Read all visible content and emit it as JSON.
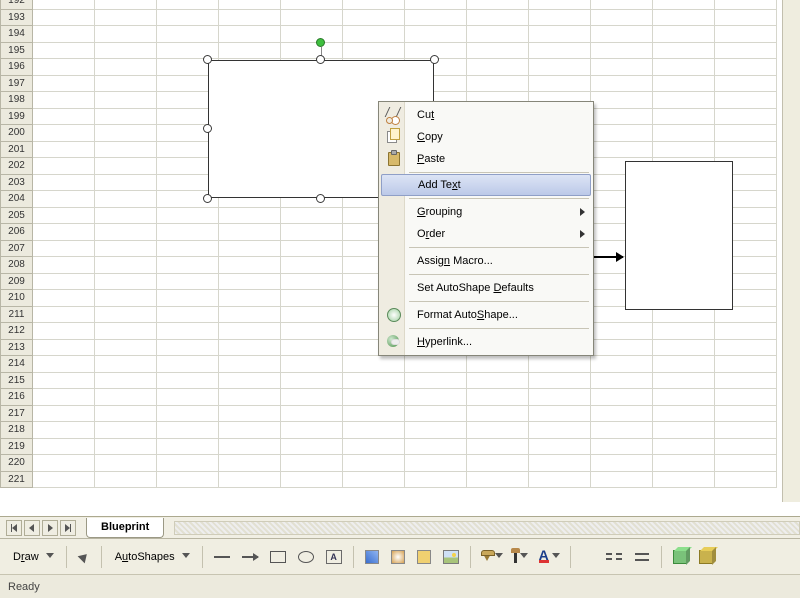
{
  "rows_start": 192,
  "rows_end": 221,
  "tab_label": "Blueprint",
  "status": "Ready",
  "context_menu": {
    "cut": "Cut",
    "copy": "Copy",
    "paste": "Paste",
    "add_text": "Add Text",
    "grouping": "Grouping",
    "order": "Order",
    "assign_macro": "Assign Macro...",
    "set_defaults": "Set AutoShape Defaults",
    "format": "Format AutoShape...",
    "hyperlink": "Hyperlink...",
    "highlighted": "add_text"
  },
  "draw_toolbar": {
    "draw": "Draw",
    "autoshapes": "AutoShapes",
    "textbox_glyph": "A"
  }
}
